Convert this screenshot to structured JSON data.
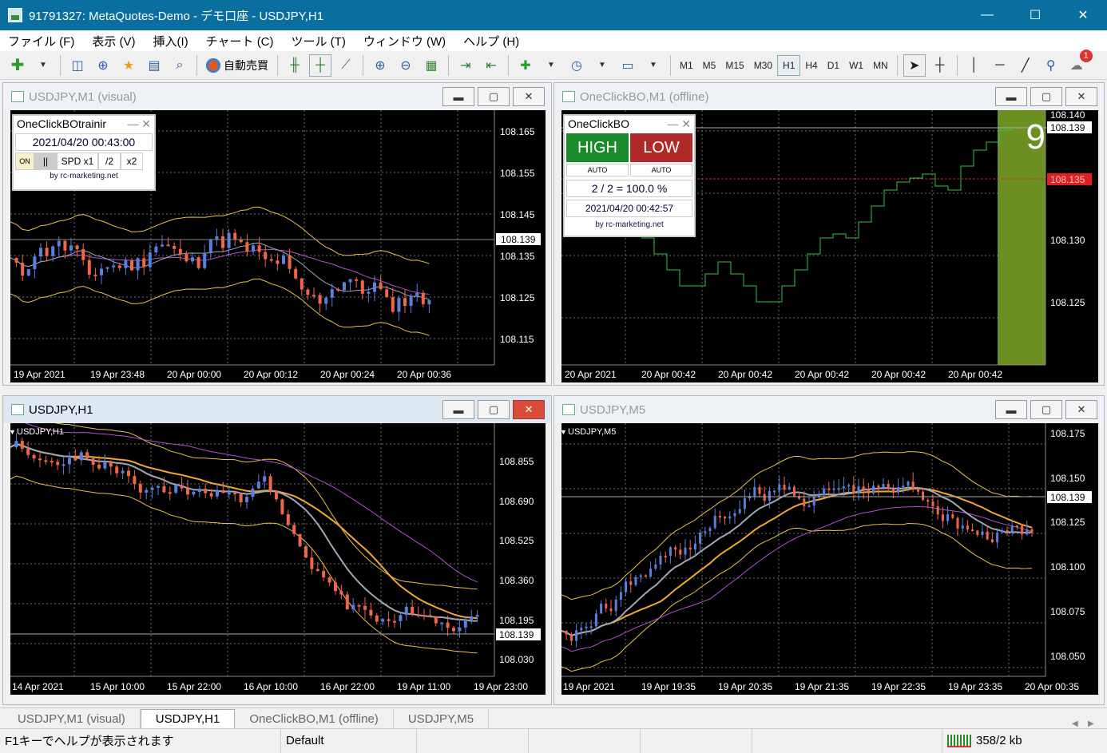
{
  "app": {
    "title": "91791327: MetaQuotes-Demo - デモ口座 - USDJPY,H1",
    "minimize": "—",
    "maximize": "☐",
    "close": "✕"
  },
  "menu": [
    "ファイル (F)",
    "表示 (V)",
    "挿入(I)",
    "チャート (C)",
    "ツール (T)",
    "ウィンドウ (W)",
    "ヘルプ (H)"
  ],
  "toolbar": {
    "autotrade_label": "自動売買",
    "timeframes": [
      "M1",
      "M5",
      "M15",
      "M30",
      "H1",
      "H4",
      "D1",
      "W1",
      "MN"
    ],
    "active_timeframe": "H1",
    "notification_count": "1"
  },
  "windows": {
    "w1": {
      "title": "USDJPY,M1 (visual)",
      "price_labels": [
        "108.165",
        "108.155",
        "108.145",
        "108.135",
        "108.125",
        "108.115"
      ],
      "current_price": "108.139",
      "time_labels": [
        "19 Apr 2021",
        "19 Apr 23:48",
        "20 Apr 00:00",
        "20 Apr 00:12",
        "20 Apr 00:24",
        "20 Apr 00:36"
      ],
      "panel": {
        "title": "OneClickBOtrainir",
        "datetime": "2021/04/20   00:43:00",
        "btn_on": "ON",
        "btn_pause": "||",
        "btn_speed": "SPD x1",
        "btn_half": "/2",
        "btn_double": "x2",
        "credit": "by rc-marketing.net"
      }
    },
    "w2": {
      "title": "OneClickBO,M1 (offline)",
      "price_labels": [
        "108.140",
        "108.130",
        "108.125"
      ],
      "current_price": "108.139",
      "red_price": "108.135",
      "countdown": "9",
      "time_labels": [
        "20 Apr 2021",
        "20 Apr 00:42",
        "20 Apr 00:42",
        "20 Apr 00:42",
        "20 Apr 00:42",
        "20 Apr 00:42"
      ],
      "panel": {
        "title": "OneClickBO",
        "high": "HIGH",
        "low": "LOW",
        "auto1": "AUTO",
        "auto2": "AUTO",
        "ratio": "2 / 2 = 100.0 %",
        "datetime": "2021/04/20  00:42:57",
        "credit": "by rc-marketing.net"
      }
    },
    "w3": {
      "title": "USDJPY,H1",
      "label": "USDJPY,H1",
      "price_labels": [
        "108.855",
        "108.690",
        "108.525",
        "108.360",
        "108.195",
        "108.030"
      ],
      "current_price": "108.139",
      "time_labels": [
        "14 Apr 2021",
        "15 Apr 10:00",
        "15 Apr 22:00",
        "16 Apr 10:00",
        "16 Apr 22:00",
        "19 Apr 11:00",
        "19 Apr 23:00"
      ]
    },
    "w4": {
      "title": "USDJPY,M5",
      "label": "USDJPY,M5",
      "price_labels": [
        "108.175",
        "108.150",
        "108.125",
        "108.100",
        "108.075",
        "108.050"
      ],
      "current_price": "108.139",
      "time_labels": [
        "19 Apr 2021",
        "19 Apr 19:35",
        "19 Apr 20:35",
        "19 Apr 21:35",
        "19 Apr 22:35",
        "19 Apr 23:35",
        "20 Apr 00:35"
      ]
    }
  },
  "tabs": [
    "USDJPY,M1 (visual)",
    "USDJPY,H1",
    "OneClickBO,M1 (offline)",
    "USDJPY,M5"
  ],
  "active_tab": "USDJPY,H1",
  "status": {
    "help": "F1キーでヘルプが表示されます",
    "profile": "Default",
    "traffic": "358/2 kb"
  },
  "colors": {
    "bull": "#5b7fe0",
    "bear": "#f0664a",
    "bands": "#e8c24a",
    "ma_slow": "#f0a830",
    "ma_fast": "#a0a8b8",
    "ma_purple": "#b44fd4",
    "line": "#33c24a",
    "panel_green": "#6c8f22"
  }
}
